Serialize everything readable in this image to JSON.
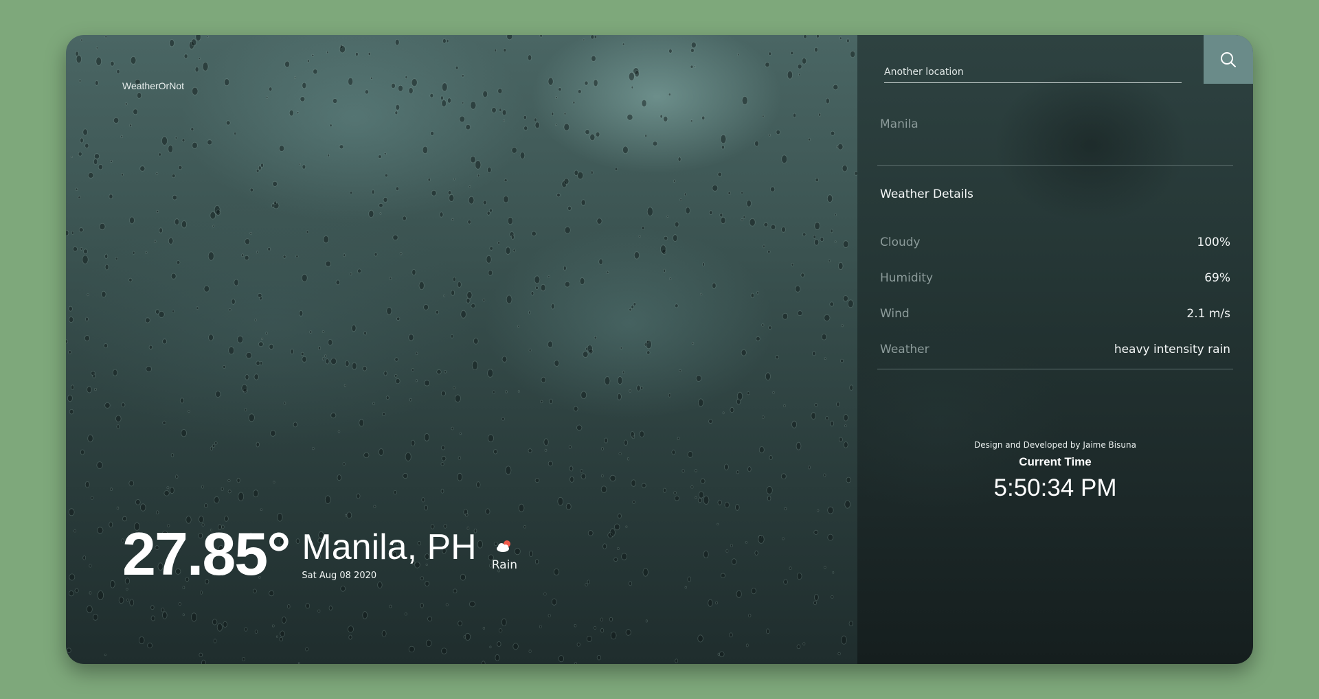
{
  "brand": "WeatherOrNot",
  "current": {
    "temperature": "27.85°",
    "city": "Manila, PH",
    "date": "Sat Aug 08 2020",
    "condition": "Rain",
    "condition_icon": "cloud-sun-icon"
  },
  "search": {
    "placeholder": "Another location",
    "value": "",
    "button_icon": "search-icon"
  },
  "recent_locations": [
    "Manila"
  ],
  "details": {
    "title": "Weather Details",
    "rows": [
      {
        "label": "Cloudy",
        "value": "100%"
      },
      {
        "label": "Humidity",
        "value": "69%"
      },
      {
        "label": "Wind",
        "value": "2.1 m/s"
      },
      {
        "label": "Weather",
        "value": "heavy intensity rain"
      }
    ]
  },
  "footer": {
    "credit": "Design and Developed by Jaime Bisuna",
    "clock_label": "Current Time",
    "clock": "5:50:34 PM"
  },
  "colors": {
    "page_background": "#7ea87b",
    "search_button": "#6a8b89",
    "muted_text": "#8c9b9a"
  }
}
